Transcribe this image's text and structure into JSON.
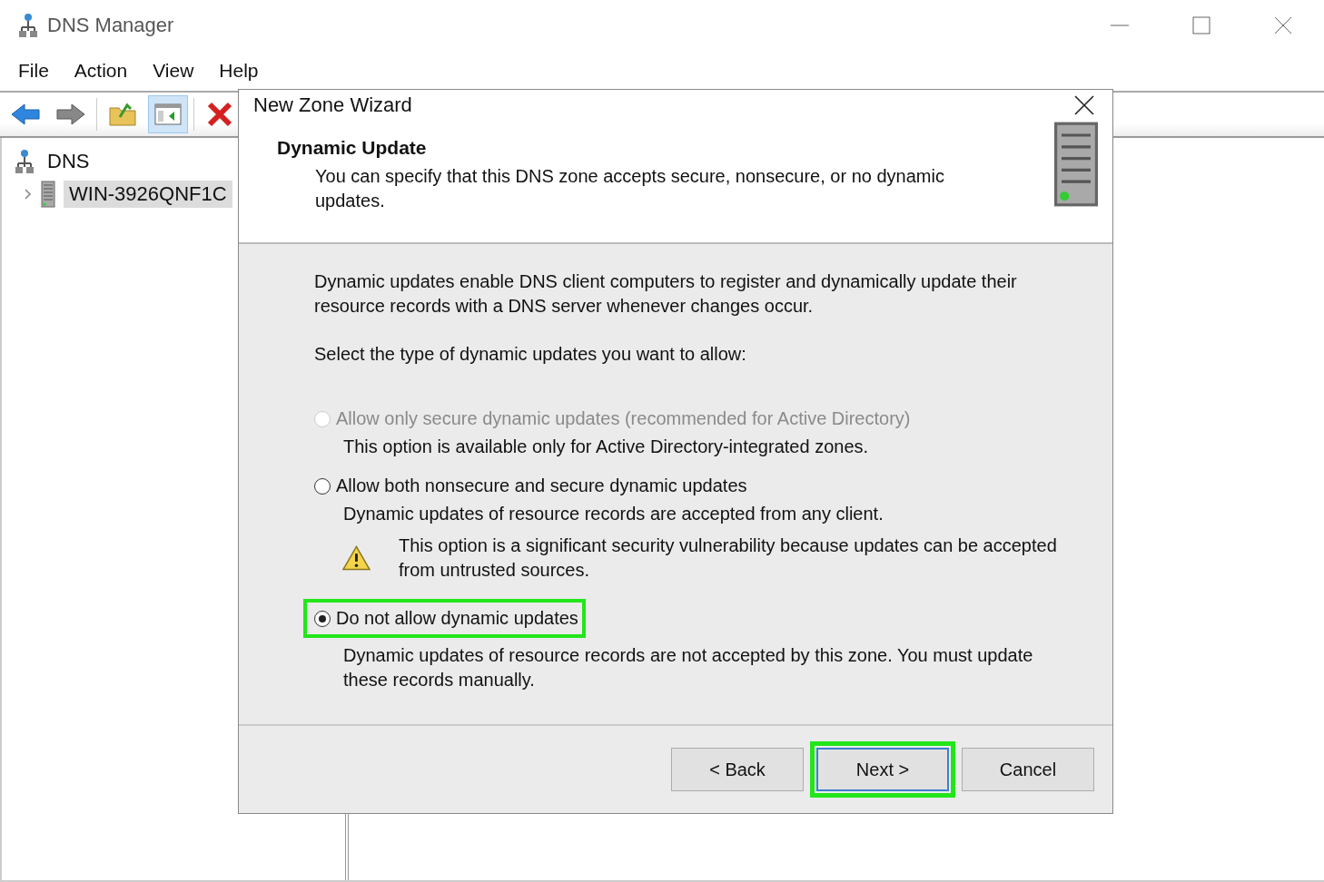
{
  "window": {
    "title": "DNS Manager"
  },
  "menu": [
    "File",
    "Action",
    "View",
    "Help"
  ],
  "toolbar": [
    {
      "kind": "back",
      "selected": false
    },
    {
      "kind": "forward",
      "selected": false
    },
    {
      "kind": "sep"
    },
    {
      "kind": "folder",
      "selected": false
    },
    {
      "kind": "pane",
      "selected": true
    },
    {
      "kind": "sep"
    },
    {
      "kind": "delete",
      "selected": false
    }
  ],
  "tree": [
    {
      "label": "DNS",
      "kind": "root",
      "children": [
        {
          "label": "WIN-3926QNF1C",
          "kind": "server",
          "expanded": false,
          "selected": true
        }
      ]
    }
  ],
  "dialog": {
    "title": "New Zone Wizard",
    "header": {
      "title": "Dynamic Update",
      "subtitle": "You can specify that this DNS zone accepts secure, nonsecure, or no dynamic updates."
    },
    "intro": "Dynamic updates enable DNS client computers to register and dynamically update their resource records with a DNS server whenever changes occur.",
    "prompt": "Select the type of dynamic updates you want to allow:",
    "options": [
      {
        "label": "Allow only secure dynamic updates (recommended for Active Directory)",
        "disabled": true,
        "selected": false,
        "highlighted": false,
        "description": "This option is available only for Active Directory-integrated zones."
      },
      {
        "label": "Allow both nonsecure and secure dynamic updates",
        "disabled": false,
        "selected": false,
        "highlighted": false,
        "description": "Dynamic updates of resource records are accepted from any client.",
        "warning": "This option is a significant security vulnerability because updates can be accepted from untrusted sources."
      },
      {
        "label": "Do not allow dynamic updates",
        "disabled": false,
        "selected": true,
        "highlighted": true,
        "description": "Dynamic updates of resource records are not accepted by this zone. You must update these records manually."
      }
    ],
    "buttons": [
      {
        "label": "< Back",
        "default": false,
        "highlighted": false
      },
      {
        "label": "Next >",
        "default": true,
        "highlighted": true
      },
      {
        "label": "Cancel",
        "default": false,
        "highlighted": false
      }
    ]
  }
}
